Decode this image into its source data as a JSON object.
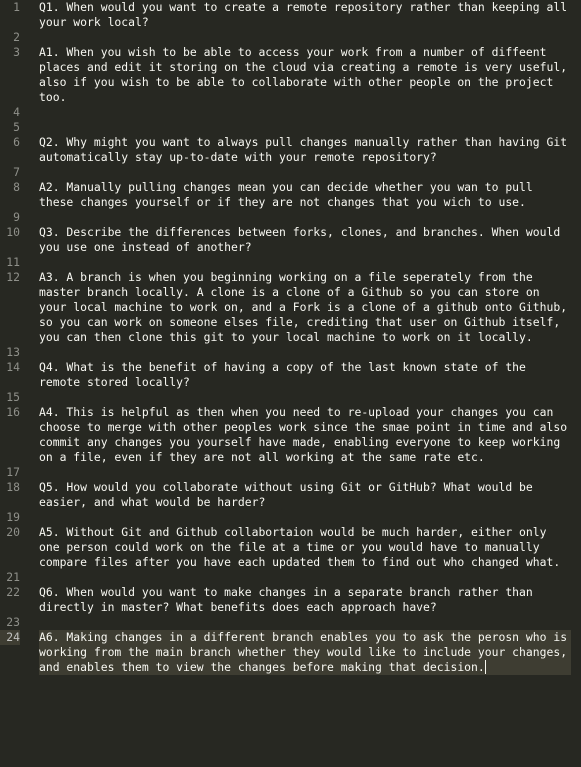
{
  "editor": {
    "lines": [
      {
        "n": "1",
        "text": "Q1. When would you want to create a remote repository rather than keeping all your work local?"
      },
      {
        "n": "2",
        "text": ""
      },
      {
        "n": "3",
        "text": "A1. When you wish to be able to access your work from a number of diffeent places and edit it storing on the cloud via creating a remote is very useful, also if you wish to be able to collaborate with other people on the project too."
      },
      {
        "n": "4",
        "text": ""
      },
      {
        "n": "5",
        "text": ""
      },
      {
        "n": "6",
        "text": "Q2. Why might you want to always pull changes manually rather than having Git automatically stay up-to-date with your remote repository?"
      },
      {
        "n": "7",
        "text": ""
      },
      {
        "n": "8",
        "text": "A2. Manually pulling changes mean you can decide whether you wan to pull these changes yourself or if they are not changes that you wich to use."
      },
      {
        "n": "9",
        "text": ""
      },
      {
        "n": "10",
        "text": "Q3. Describe the differences between forks, clones, and branches. When would you use one instead of another?"
      },
      {
        "n": "11",
        "text": ""
      },
      {
        "n": "12",
        "text": "A3. A branch is when you beginning working on a file seperately from the master branch locally. A clone is a clone of a Github so you can store on your local machine to work on, and a Fork is a clone of a github onto Github, so you can work on someone elses file, crediting that user on Github itself, you can then clone this git to your local machine to work on it locally."
      },
      {
        "n": "13",
        "text": ""
      },
      {
        "n": "14",
        "text": "Q4. What is the benefit of having a copy of the last known state of the remote stored locally?"
      },
      {
        "n": "15",
        "text": ""
      },
      {
        "n": "16",
        "text": "A4. This is helpful as then when you need to re-upload your changes you can choose to merge with other peoples work since the smae point in time and also commit any changes you yourself have made, enabling everyone to keep working on a file, even if they are not all working at the same rate etc."
      },
      {
        "n": "17",
        "text": ""
      },
      {
        "n": "18",
        "text": "Q5. How would you collaborate without using Git or GitHub? What would be easier, and what would be harder?"
      },
      {
        "n": "19",
        "text": ""
      },
      {
        "n": "20",
        "text": "A5. Without Git and Github collabortaion would be much harder, either only one person could work on the file at a time or you would have to manually compare files after you have each updated them to find out who changed what."
      },
      {
        "n": "21",
        "text": ""
      },
      {
        "n": "22",
        "text": "Q6. When would you want to make changes in a separate branch rather than directly in master? What benefits does each approach have?"
      },
      {
        "n": "23",
        "text": ""
      },
      {
        "n": "24",
        "text": "A6. Making changes in a different branch enables you to ask the perosn who is working from the main branch whether they would like to include your changes, and enables them to view the changes before making that decision."
      }
    ]
  }
}
